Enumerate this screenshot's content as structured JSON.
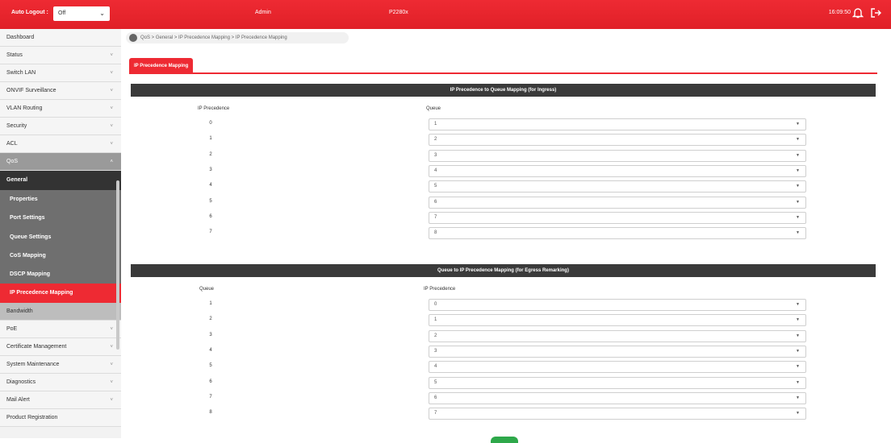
{
  "topbar": {
    "auto_logout_label": "Auto Logout :",
    "auto_logout_value": "Off",
    "user": "Admin",
    "model": "P2280x",
    "time": "16:09:50"
  },
  "sidebar": {
    "items_top": [
      "Dashboard",
      "Status",
      "Switch LAN",
      "ONVIF Surveillance",
      "VLAN Routing",
      "Security",
      "ACL",
      "QoS"
    ],
    "qos_sub_head": "General",
    "qos_sub_items": [
      "Properties",
      "Port Settings",
      "Queue Settings",
      "CoS Mapping",
      "DSCP Mapping",
      "IP Precedence Mapping"
    ],
    "bandwidth": "Bandwidth",
    "items_bottom": [
      "PoE",
      "Certificate Management",
      "System Maintenance",
      "Diagnostics",
      "Mail Alert",
      "Product Registration"
    ]
  },
  "breadcrumb": "QoS > General > IP Precedence Mapping > IP Precedence Mapping",
  "tab_label": "IP Precedence Mapping",
  "ingress": {
    "title": "IP Precedence to Queue Mapping (for Ingress)",
    "col1": "IP Precedence",
    "col2": "Queue",
    "rows": [
      {
        "label": "0",
        "value": "1"
      },
      {
        "label": "1",
        "value": "2"
      },
      {
        "label": "2",
        "value": "3"
      },
      {
        "label": "3",
        "value": "4"
      },
      {
        "label": "4",
        "value": "5"
      },
      {
        "label": "5",
        "value": "6"
      },
      {
        "label": "6",
        "value": "7"
      },
      {
        "label": "7",
        "value": "8"
      }
    ]
  },
  "egress": {
    "title": "Queue to IP Precedence Mapping (for Egress Remarking)",
    "col1": "Queue",
    "col2": "IP Precedence",
    "rows": [
      {
        "label": "1",
        "value": "0"
      },
      {
        "label": "2",
        "value": "1"
      },
      {
        "label": "3",
        "value": "2"
      },
      {
        "label": "4",
        "value": "3"
      },
      {
        "label": "5",
        "value": "4"
      },
      {
        "label": "6",
        "value": "5"
      },
      {
        "label": "7",
        "value": "6"
      },
      {
        "label": "8",
        "value": "7"
      }
    ]
  },
  "colors": {
    "accent": "#ee2a33",
    "dark": "#3a3a3a",
    "sub_bg": "#6f6f6f"
  }
}
